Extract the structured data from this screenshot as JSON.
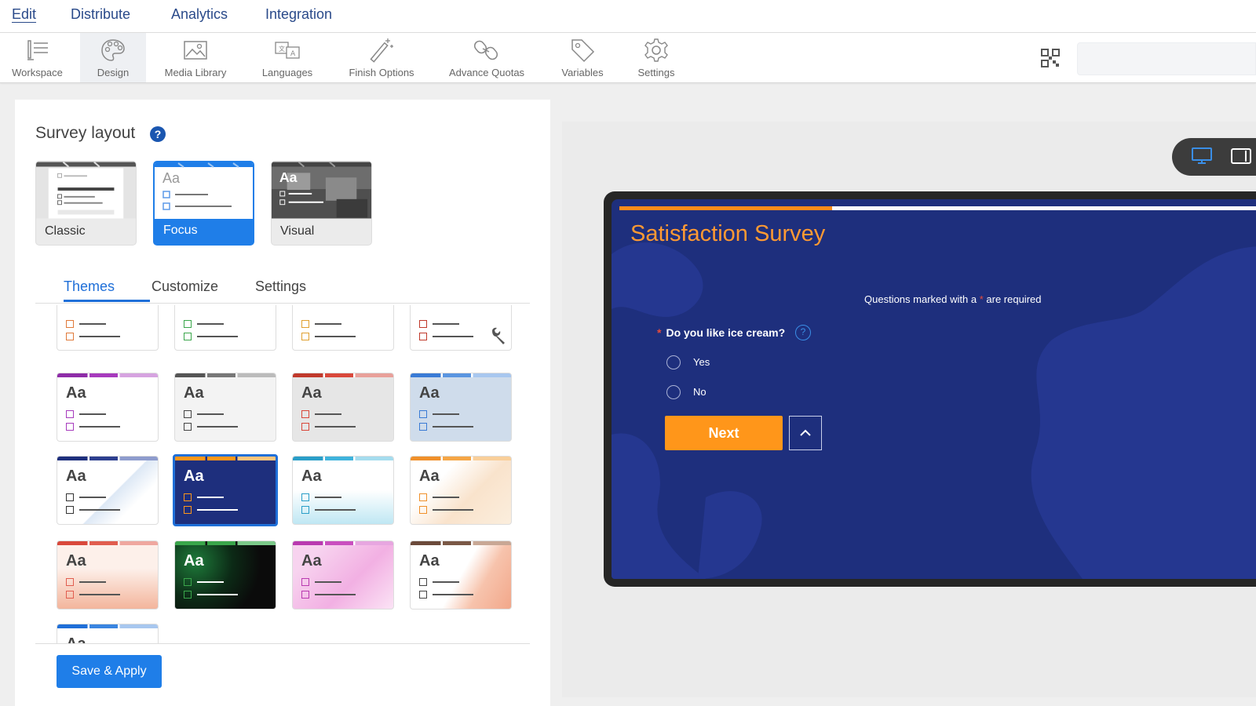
{
  "topnav": {
    "tabs": [
      {
        "label": "Edit",
        "active": true
      },
      {
        "label": "Distribute"
      },
      {
        "label": "Analytics"
      },
      {
        "label": "Integration"
      }
    ]
  },
  "toolbar": {
    "items": [
      {
        "label": "Workspace",
        "icon": "workspace-icon"
      },
      {
        "label": "Design",
        "icon": "palette-icon",
        "active": true
      },
      {
        "label": "Media Library",
        "icon": "image-icon"
      },
      {
        "label": "Languages",
        "icon": "translate-icon"
      },
      {
        "label": "Finish Options",
        "icon": "magic-wand-icon"
      },
      {
        "label": "Advance Quotas",
        "icon": "link-icon"
      },
      {
        "label": "Variables",
        "icon": "tag-icon"
      },
      {
        "label": "Settings",
        "icon": "gear-icon"
      }
    ],
    "qr_icon": "qr-code-icon"
  },
  "left_panel": {
    "title": "Survey layout",
    "help_glyph": "?",
    "layouts": [
      {
        "label": "Classic"
      },
      {
        "label": "Focus",
        "selected": true
      },
      {
        "label": "Visual"
      }
    ],
    "subtabs": [
      {
        "label": "Themes",
        "active": true
      },
      {
        "label": "Customize"
      },
      {
        "label": "Settings"
      }
    ],
    "theme_aa": "Aa",
    "save_button": "Save & Apply"
  },
  "preview": {
    "device_modes": [
      "desktop-icon",
      "tablet-icon"
    ],
    "survey_title": "Satisfaction Survey",
    "required_note_before": "Questions marked with a",
    "required_star": "*",
    "required_note_after": "are required",
    "question": "Do you like ice cream?",
    "question_help": "?",
    "options": [
      "Yes",
      "No"
    ],
    "next_button": "Next",
    "progress_fraction": 0.33,
    "colors": {
      "survey_bg": "#1e2f7d",
      "accent": "#ff961a"
    }
  }
}
